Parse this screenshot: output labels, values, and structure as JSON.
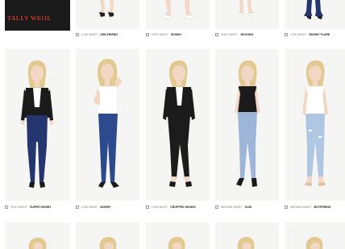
{
  "brand": {
    "logo_text": "TALLY WEiJL"
  },
  "colors": {
    "card_bg": "#f5f5f3",
    "logo_bg": "#1a1a1a",
    "logo_text": "#d33a2a",
    "hair": "#e2c98f",
    "skin": "#f2d7c4",
    "dark_denim": "#25356e",
    "mid_denim": "#2e4a8f",
    "black_denim": "#1c1c1c",
    "light_denim": "#9cb5d8",
    "pale_denim": "#b0c7e4",
    "top_black": "#1b1b1b",
    "top_white": "#ffffff"
  },
  "top_row_captions": [
    {
      "rise": "LOW WAIST",
      "name": "GIRLFRIEND"
    },
    {
      "rise": "HIGH WAIST",
      "name": "SKINNY"
    },
    {
      "rise": "HIGH WAIST",
      "name": "JEGGING"
    },
    {
      "rise": "LOW WAIST",
      "name": "SKINNY FLARE"
    }
  ],
  "middle_row": [
    {
      "rise": "HIGH WAIST",
      "name": "SUPER SKINNY",
      "top": "black",
      "jeans": "dark_denim"
    },
    {
      "rise": "LOW WAIST",
      "name": "SKINNY",
      "top": "white",
      "jeans": "mid_denim"
    },
    {
      "rise": "LOW WAIST",
      "name": "CROPPED SKINNY",
      "top": "black",
      "jeans": "black_denim"
    },
    {
      "rise": "MEDIUM WAIST",
      "name": "SLIM",
      "top": "black",
      "jeans": "light_denim"
    },
    {
      "rise": "MEDIUM WAIST",
      "name": "BOYFRIEND",
      "top": "white",
      "jeans": "pale_denim"
    }
  ]
}
